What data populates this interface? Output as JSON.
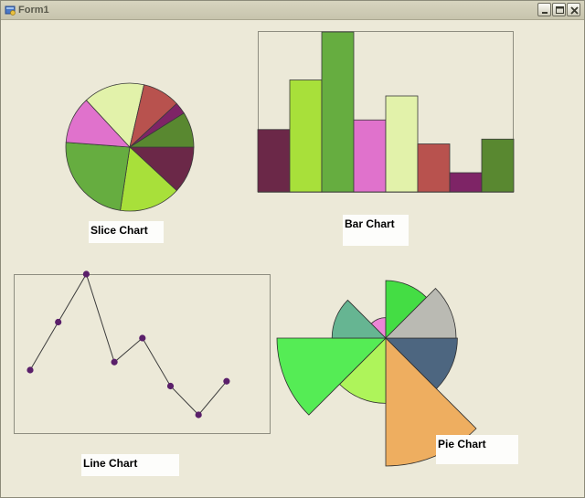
{
  "window": {
    "title": "Form1",
    "controls": {
      "minimize": "minimize-icon",
      "maximize": "maximize-icon",
      "close": "close-icon"
    }
  },
  "labels": {
    "slice": "Slice Chart",
    "bar": "Bar Chart",
    "line": "Line Chart",
    "pie": "Pie Chart"
  },
  "chart_data": [
    {
      "type": "pie",
      "name_label": "Slice Chart",
      "start_angle_deg": 0,
      "direction": "clockwise",
      "slices": [
        {
          "value": 1.0,
          "color": "#6b2848"
        },
        {
          "value": 1.3,
          "color": "#a8e03a"
        },
        {
          "value": 2.0,
          "color": "#66ad40"
        },
        {
          "value": 1.0,
          "color": "#e072cc"
        },
        {
          "value": 1.3,
          "color": "#e2f2aa"
        },
        {
          "value": 0.8,
          "color": "#b8524e"
        },
        {
          "value": 0.25,
          "color": "#7e2466"
        },
        {
          "value": 0.75,
          "color": "#598830"
        }
      ]
    },
    {
      "type": "bar",
      "name_label": "Bar Chart",
      "ylim": [
        0,
        10
      ],
      "values": [
        3.9,
        7.0,
        10.0,
        4.5,
        6.0,
        3.0,
        1.2,
        3.3
      ],
      "colors": [
        "#6b2848",
        "#a8e03a",
        "#66ad40",
        "#e072cc",
        "#e2f2aa",
        "#b8524e",
        "#7e2466",
        "#598830"
      ]
    },
    {
      "type": "line",
      "name_label": "Line Chart",
      "ylim": [
        0,
        10
      ],
      "values": [
        4.0,
        7.0,
        10.0,
        4.5,
        6.0,
        3.0,
        1.2,
        3.3
      ],
      "line_color": "#3c3c3c",
      "point_color": "#5a1f6a"
    },
    {
      "type": "pie",
      "subtype": "polar-area",
      "name_label": "Pie Chart",
      "start_angle_deg": 0,
      "direction": "clockwise",
      "max_radius": 100,
      "sectors": [
        {
          "radius": 56,
          "color": "#4d6680"
        },
        {
          "radius": 100,
          "color": "#eeae60"
        },
        {
          "radius": 51,
          "color": "#aef45a"
        },
        {
          "radius": 85,
          "color": "#55ec55"
        },
        {
          "radius": 42,
          "color": "#66b592"
        },
        {
          "radius": 16,
          "color": "#ec86d6"
        },
        {
          "radius": 45,
          "color": "#44dd44"
        },
        {
          "radius": 55,
          "color": "#babab3"
        }
      ]
    }
  ]
}
